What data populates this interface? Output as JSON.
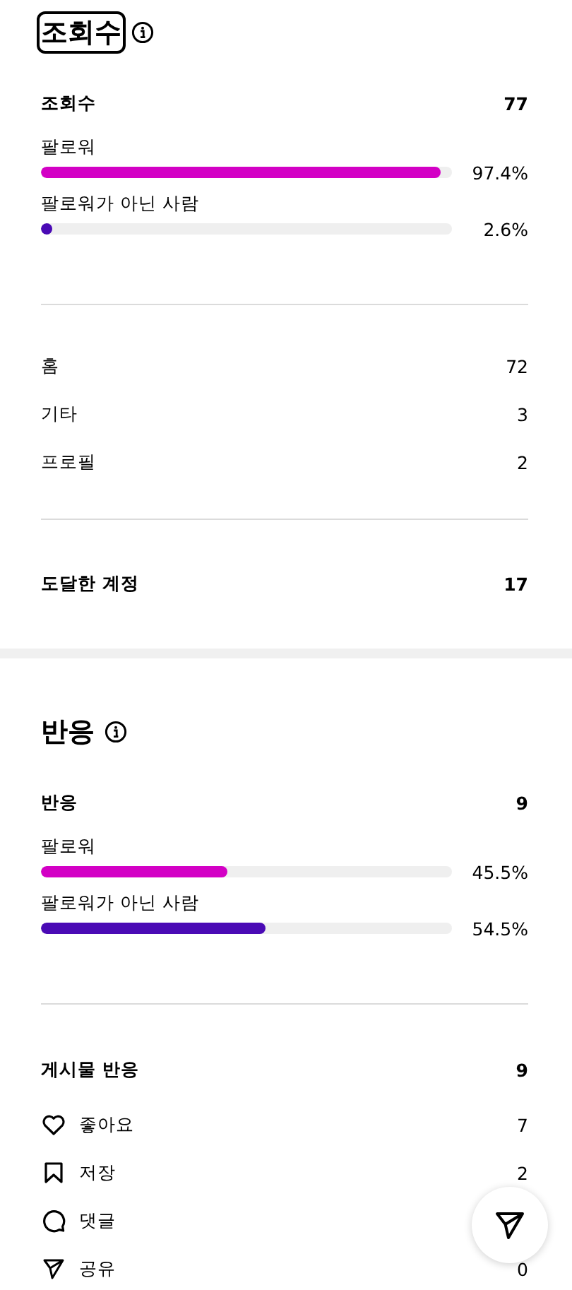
{
  "sections": [
    {
      "title": "조회수",
      "focused": true,
      "blocks": [
        {
          "kind": "stats",
          "header": {
            "label": "조회수",
            "value": "77"
          },
          "bars": [
            {
              "label": "팔로워",
              "level": 0.974,
              "reading": "97.4%",
              "color": "#d300c5"
            },
            {
              "label": "팔로워가 아닌 사람",
              "level": 0.026,
              "reading": "2.6%",
              "color": "#4a0ab5"
            }
          ]
        },
        {
          "kind": "list",
          "rows": [
            {
              "label": "홈",
              "value": "72"
            },
            {
              "label": "기타",
              "value": "3"
            },
            {
              "label": "프로필",
              "value": "2"
            }
          ]
        },
        {
          "kind": "total",
          "label": "도달한 계정",
          "value": "17"
        }
      ]
    },
    {
      "title": "반응",
      "focused": false,
      "blocks": [
        {
          "kind": "stats",
          "header": {
            "label": "반응",
            "value": "9"
          },
          "bars": [
            {
              "label": "팔로워",
              "level": 0.455,
              "reading": "45.5%",
              "color": "#d300c5"
            },
            {
              "label": "팔로워가 아닌 사람",
              "level": 0.545,
              "reading": "54.5%",
              "color": "#4a0ab5"
            }
          ]
        },
        {
          "kind": "reactions",
          "header": {
            "label": "게시물 반응",
            "value": "9"
          },
          "rows": [
            {
              "kind": "like",
              "label": "좋아요",
              "value": "7"
            },
            {
              "kind": "save",
              "label": "저장",
              "value": "2"
            },
            {
              "kind": "comment",
              "label": "댓글"
            },
            {
              "kind": "share",
              "label": "공유",
              "value": "0"
            }
          ]
        }
      ]
    }
  ]
}
